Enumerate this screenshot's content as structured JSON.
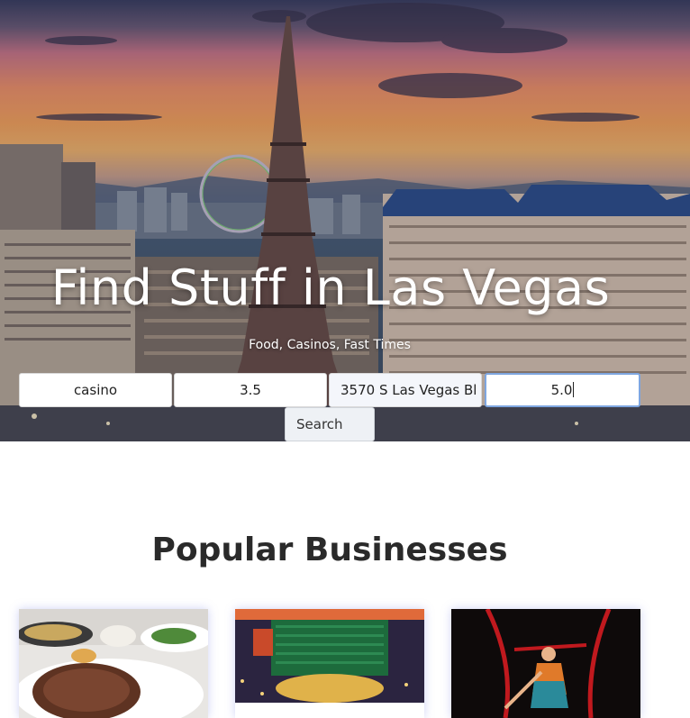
{
  "hero": {
    "title": "Find Stuff in Las Vegas",
    "subtitle": "Food, Casinos, Fast Times"
  },
  "search": {
    "term_value": "casino",
    "rating_value": "3.5",
    "address_value": "3570 S Las Vegas Bl",
    "radius_value": "5.0",
    "button_label": "Search"
  },
  "popular": {
    "title": "Popular Businesses",
    "cards": [
      {
        "image": "steak-dinner-photo"
      },
      {
        "image": "mgm-grand-photo"
      },
      {
        "image": "acrobat-performer-photo"
      }
    ]
  },
  "colors": {
    "focus_border": "#7ea6e0",
    "card_shadow": "#7882e6",
    "title_text": "#2a2a2a"
  }
}
